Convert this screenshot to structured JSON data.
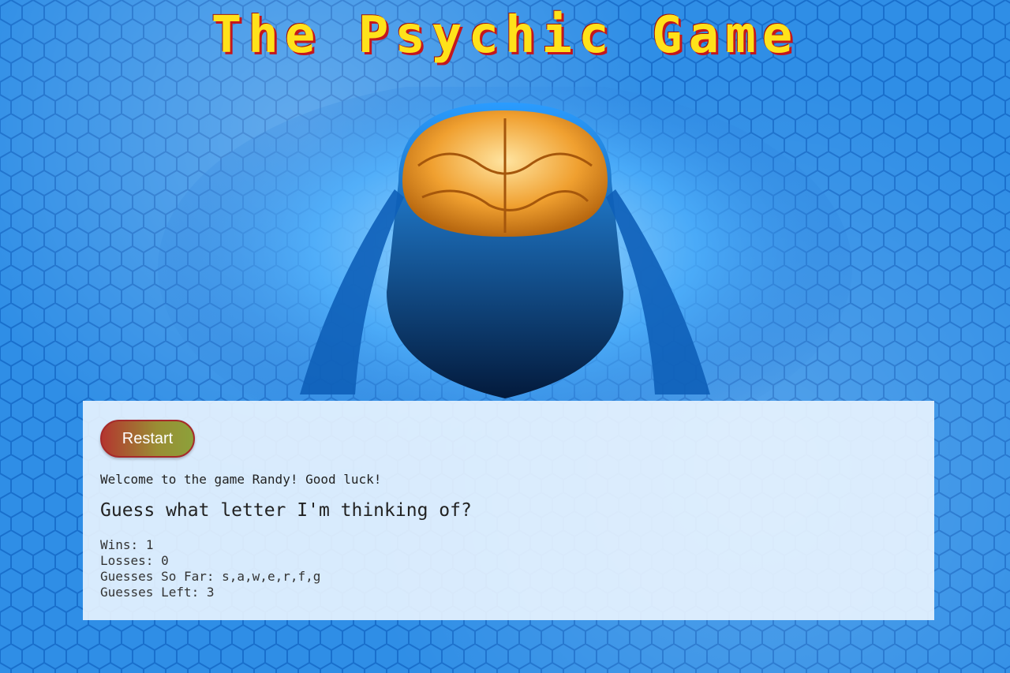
{
  "title": "The Psychic Game",
  "panel": {
    "restart_label": "Restart",
    "welcome": "Welcome to the game Randy! Good luck!",
    "question": "Guess what letter I'm thinking of?",
    "wins_label": "Wins:",
    "wins": "1",
    "losses_label": "Losses:",
    "losses": "0",
    "guesses_label": "Guesses So Far:",
    "guesses": "s,a,w,e,r,f,g",
    "left_label": "Guesses Left:",
    "left": "3"
  },
  "colors": {
    "title": "#ffe21a",
    "title_shadow": "#c5161c",
    "background": "#2f8ee6",
    "brain": "#f0a030"
  }
}
